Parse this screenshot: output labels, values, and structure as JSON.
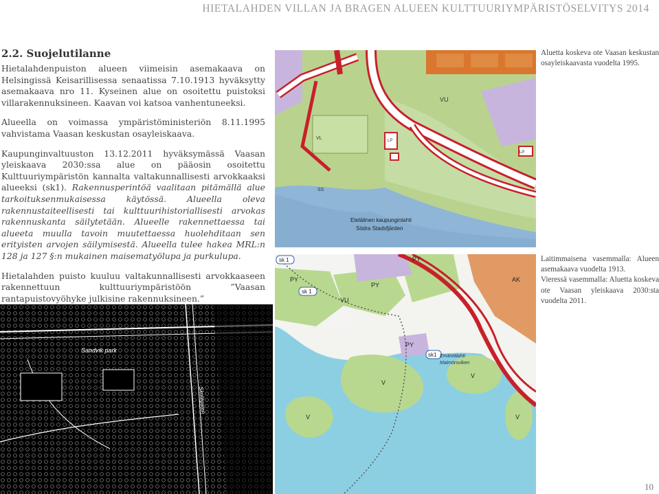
{
  "header": {
    "title": "HIETALAHDEN VILLAN JA BRAGEN ALUEEN KULTTUURIYMPÄRISTÖSELVITYS 2014"
  },
  "section": {
    "title": "2.2.  Suojelutilanne"
  },
  "body": {
    "p1": "Hietalahdenpuiston alueen viimeisin asemakaava on Helsingissä Keisarillisessa senaatissa 7.10.1913 hyväksytty asemakaava nro 11. Kyseinen alue on osoitettu puistoksi villarakennuksineen. Kaavan voi katsoa vanhentuneeksi.",
    "p2": "Alueella on voimassa ympäristöministeriön 8.11.1995 vahvistama Vaasan keskustan osayleiskaava.",
    "p3_plain": "Kaupunginvaltuuston 13.12.2011 hyväksymässä Vaasan yleiskaava 2030:ssa alue on pääosin osoitettu Kulttuuriympäristön kannalta valtakunnallisesti arvokkaaksi alueeksi (sk1). ",
    "p3_italic": "Rakennusperintöä vaalitaan pitämällä alue tarkoituksenmukaisessa käytössä. Alueella oleva rakennustaiteellisesti tai kulttuurihistoriallisesti arvokas rakennuskanta säilytetään. Alueelle rakennettaessa tai alueeta muulla tavoin muutettaessa huolehditaan sen erityisten arvojen säilymisestä. Alueella tulee hakea MRL:n 128 ja 127 §:n mukainen maisematyölupa ja purkulupa.",
    "p4": "Hietalahden puisto kuuluu valtakunnallisesti arvokkaaseen rakennettuun kulttuuriympäristöön ”Vaasan rantapuistovyöhyke julkisine rakennuksineen.”"
  },
  "captions": {
    "top": "Aluetta koskeva ote Vaasan keskustan osayleiskaavasta vuodelta 1995.",
    "bottom_1": "Laitimmaisena vasemmalla: Alueen asemakaava vuodelta 1913.",
    "bottom_2": "Vieressä vasemmalla: Aluetta koskeva ote Vaasan yleiskaava 2030:sta vuodelta 2011."
  },
  "map_1995": {
    "labels": [
      "VU",
      "LP",
      "LP",
      "VL",
      "SS",
      "Etelälinen kaupunginlahti",
      "Södra Stadsfjärden"
    ]
  },
  "map_2011": {
    "labels": [
      "sk 1",
      "sk 1",
      "PY",
      "PY",
      "PY",
      "VU",
      "AK",
      "V",
      "V",
      "V",
      "V",
      "PY",
      "sk1",
      "Emäntälahti",
      "Malmörsviken"
    ]
  },
  "map_1913": {
    "labels": [
      "Sandvik park",
      "Skolitgaten"
    ]
  },
  "colors": {
    "accent_red": "#c8202b",
    "water_blue": "#9fc3df",
    "park_green": "#b8d88f",
    "orange": "#d9772e",
    "purple": "#c7b5dd"
  },
  "page": {
    "number": "10"
  }
}
